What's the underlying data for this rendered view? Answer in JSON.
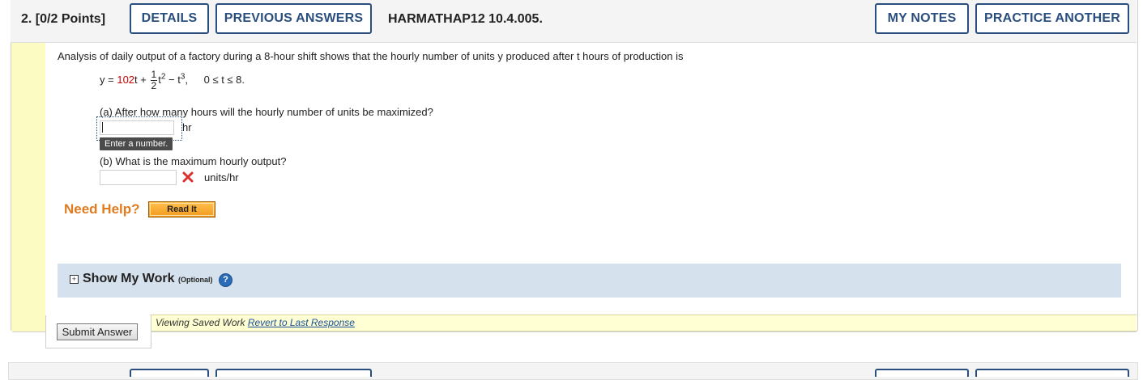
{
  "header": {
    "question_number": "2.",
    "points": "[0/2 Points]",
    "details_label": "DETAILS",
    "previous_answers_label": "PREVIOUS ANSWERS",
    "problem_code": "HARMATHAP12 10.4.005.",
    "my_notes_label": "MY NOTES",
    "practice_another_label": "PRACTICE ANOTHER"
  },
  "problem": {
    "statement": "Analysis of daily output of a factory during a 8-hour shift shows that the hourly number of units y produced after t hours of production is",
    "equation": {
      "lhs": "y =",
      "coef": "102",
      "t1": "t +",
      "frac_num": "1",
      "frac_den": "2",
      "t2": "t",
      "exp2": "2",
      "minus": " − t",
      "exp3": "3",
      "comma": ",",
      "domain": "0 ≤ t ≤ 8."
    }
  },
  "part_a": {
    "question": "(a) After how many hours will the hourly number of units be maximized?",
    "value": "",
    "unit": "hr",
    "tooltip": "Enter a number."
  },
  "part_b": {
    "question": "(b) What is the maximum hourly output?",
    "value": "",
    "status_icon": "incorrect-x-icon",
    "unit": "units/hr"
  },
  "help": {
    "label": "Need Help?",
    "read_it_label": "Read It"
  },
  "show_my_work": {
    "expand_glyph": "+",
    "label": "Show My Work",
    "optional": "(Optional)",
    "help_glyph": "?"
  },
  "footer": {
    "submit_label": "Submit Answer",
    "saved_text": "Viewing Saved Work ",
    "revert_link": "Revert to Last Response"
  },
  "colors": {
    "accent_blue": "#2a4f7e",
    "help_orange": "#e07b1f",
    "incorrect_red": "#d9322e",
    "stripe_yellow": "#fbfbc2",
    "show_work_bg": "#d5e1ec"
  }
}
